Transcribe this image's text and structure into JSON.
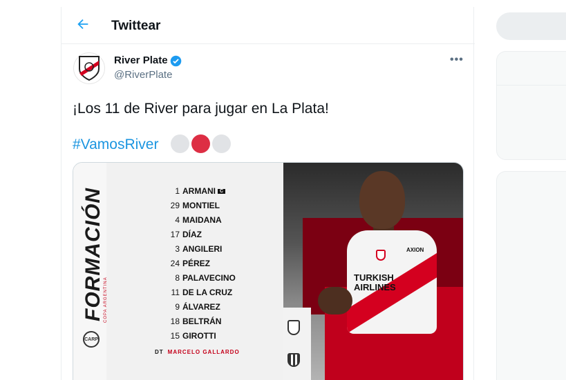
{
  "header": {
    "title": "Twittear"
  },
  "tweet": {
    "author_name": "River Plate",
    "author_handle": "@RiverPlate",
    "text": "¡Los 11 de River para jugar en La Plata!",
    "hashtag": "#VamosRiver",
    "emoji_colors": [
      "#e1e3e6",
      "#dd2e44",
      "#e1e3e6"
    ]
  },
  "graphic": {
    "title": "FORMACIÓN",
    "subtitle": "COPA ARGENTINA",
    "captain_badge": "C",
    "players": [
      {
        "number": "1",
        "name": "ARMANI"
      },
      {
        "number": "29",
        "name": "MONTIEL"
      },
      {
        "number": "4",
        "name": "MAIDANA"
      },
      {
        "number": "17",
        "name": "DÍAZ"
      },
      {
        "number": "3",
        "name": "ANGILERI"
      },
      {
        "number": "24",
        "name": "PÉREZ"
      },
      {
        "number": "8",
        "name": "PALAVECINO"
      },
      {
        "number": "11",
        "name": "DE LA CRUZ"
      },
      {
        "number": "9",
        "name": "ÁLVAREZ"
      },
      {
        "number": "18",
        "name": "BELTRÁN"
      },
      {
        "number": "15",
        "name": "GIROTTI"
      }
    ],
    "coach_label": "DT",
    "coach_name": "MARCELO GALLARDO",
    "crest_text": "CARP",
    "shirt_sponsor": "TURKISH AIRLINES",
    "shirt_partner": "AXION"
  },
  "colors": {
    "link": "#1b95e0",
    "verified": "#1d9bf0",
    "river_red": "#d4001f"
  }
}
